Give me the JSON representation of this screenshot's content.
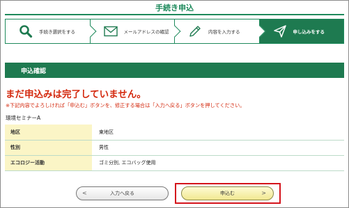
{
  "page": {
    "title": "手続き申込"
  },
  "steps": [
    {
      "label": "手続き選択をする",
      "icon": "search-icon",
      "active": false
    },
    {
      "label": "メールアドレスの確認",
      "icon": "mail-icon",
      "active": false
    },
    {
      "label": "内容を入力する",
      "icon": "pencil-icon",
      "active": false
    },
    {
      "label": "申し込みをする",
      "icon": "send-icon",
      "active": true
    }
  ],
  "section": {
    "header": "申込確認"
  },
  "warning": {
    "title": "まだ申込みは完了していません。",
    "note": "※下記内容でよろしければ「申込む」ボタンを、修正する場合は「入力へ戻る」ボタンを押してください。"
  },
  "seminar": {
    "name": "環境セミナーA"
  },
  "details": [
    {
      "key": "地区",
      "value": "東地区"
    },
    {
      "key": "性別",
      "value": "男性"
    },
    {
      "key": "エコロジー活動",
      "value": "ゴミ分別, エコバッグ使用"
    }
  ],
  "buttons": {
    "back_label": "入力へ戻る",
    "back_chevron": "<",
    "submit_label": "申込む",
    "submit_chevron": ">"
  },
  "colors": {
    "brand_green": "#1e7a50",
    "warning_red": "#d42a0f",
    "key_cell_bg": "#fbf5c6",
    "highlight_red": "#d4141c"
  }
}
